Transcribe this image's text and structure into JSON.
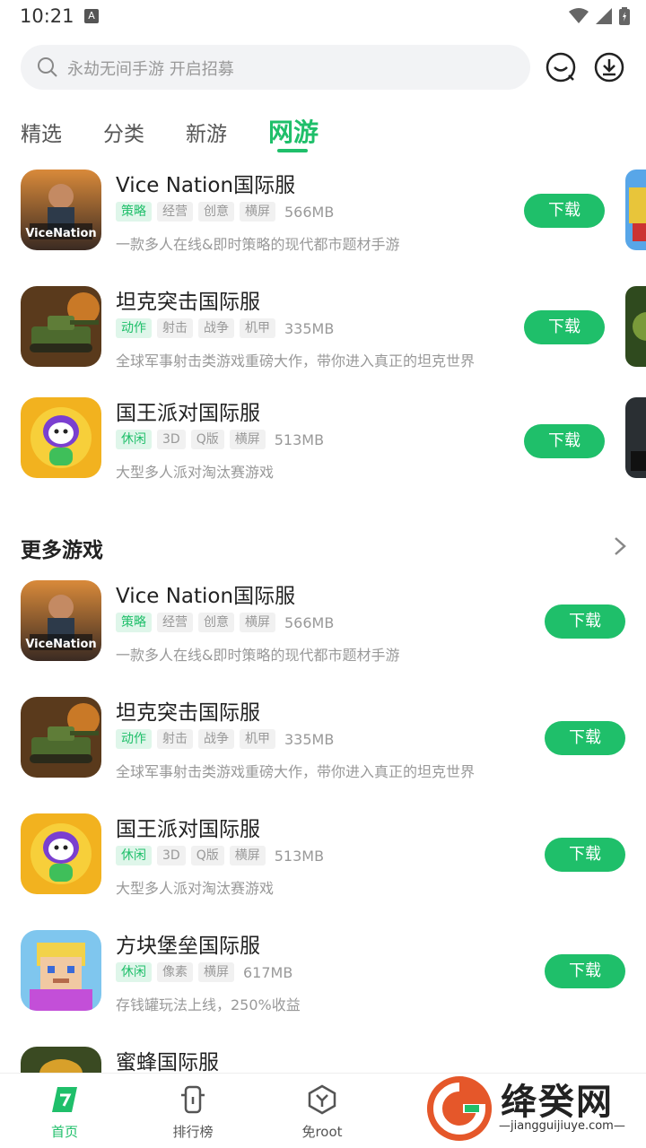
{
  "status_bar": {
    "time": "10:21",
    "a_icon": "A"
  },
  "search": {
    "placeholder": "永劫无间手游 开启招募"
  },
  "tabs": [
    {
      "label": "精选"
    },
    {
      "label": "分类"
    },
    {
      "label": "新游"
    },
    {
      "label": "网游",
      "active": true
    }
  ],
  "featured": [
    {
      "name": "Vice Nation国际服",
      "tags": [
        "策略",
        "经营",
        "创意",
        "横屏"
      ],
      "size": "566MB",
      "desc": "一款多人在线&即时策略的现代都市题材手游",
      "button": "下载"
    },
    {
      "name": "坦克突击国际服",
      "tags": [
        "动作",
        "射击",
        "战争",
        "机甲"
      ],
      "size": "335MB",
      "desc": "全球军事射击类游戏重磅大作，带你进入真正的坦克世界",
      "button": "下载"
    },
    {
      "name": "国王派对国际服",
      "tags": [
        "休闲",
        "3D",
        "Q版",
        "横屏"
      ],
      "size": "513MB",
      "desc": "大型多人派对淘汰赛游戏",
      "button": "下载"
    }
  ],
  "more_games": {
    "title": "更多游戏",
    "items": [
      {
        "name": "Vice Nation国际服",
        "tags": [
          "策略",
          "经营",
          "创意",
          "横屏"
        ],
        "size": "566MB",
        "desc": "一款多人在线&即时策略的现代都市题材手游",
        "button": "下载"
      },
      {
        "name": "坦克突击国际服",
        "tags": [
          "动作",
          "射击",
          "战争",
          "机甲"
        ],
        "size": "335MB",
        "desc": "全球军事射击类游戏重磅大作，带你进入真正的坦克世界",
        "button": "下载"
      },
      {
        "name": "国王派对国际服",
        "tags": [
          "休闲",
          "3D",
          "Q版",
          "横屏"
        ],
        "size": "513MB",
        "desc": "大型多人派对淘汰赛游戏",
        "button": "下载"
      },
      {
        "name": "方块堡垒国际服",
        "tags": [
          "休闲",
          "像素",
          "横屏"
        ],
        "size": "617MB",
        "desc": "存钱罐玩法上线，250%收益",
        "button": "下载"
      },
      {
        "name": "蜜蜂国际服"
      }
    ]
  },
  "bottom_nav": [
    {
      "label": "首页",
      "active": true
    },
    {
      "label": "排行榜"
    },
    {
      "label": "免root"
    }
  ],
  "watermark": {
    "text": "绛癸网",
    "url": "—jiangguijiuye.com—"
  },
  "colors": {
    "accent": "#1fbf6a",
    "tag_bg": "#f1f1f1",
    "tag_green_bg": "#dff6ea"
  }
}
